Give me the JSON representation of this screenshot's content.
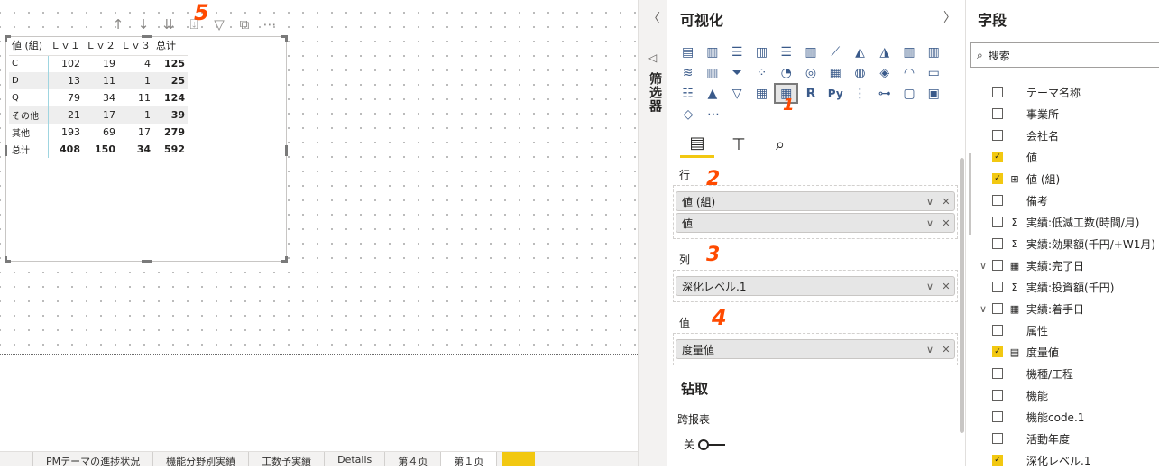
{
  "canvas": {
    "matrix": {
      "headers": [
        "値 (組)",
        "Ｌｖ１",
        "Ｌｖ２",
        "Ｌｖ３",
        "总计"
      ],
      "rows": [
        {
          "label": "C",
          "v1": "102",
          "v2": "19",
          "v3": "4",
          "total": "125"
        },
        {
          "label": "D",
          "v1": "13",
          "v2": "11",
          "v3": "1",
          "total": "25"
        },
        {
          "label": "Q",
          "v1": "79",
          "v2": "34",
          "v3": "11",
          "total": "124"
        },
        {
          "label": "その他",
          "v1": "21",
          "v2": "17",
          "v3": "1",
          "total": "39"
        },
        {
          "label": "其他",
          "v1": "193",
          "v2": "69",
          "v3": "17",
          "total": "279"
        }
      ],
      "grand_total": {
        "label": "总计",
        "v1": "408",
        "v2": "150",
        "v3": "34",
        "total": "592"
      }
    },
    "visual_header_icons": [
      "arrow-up-icon",
      "arrow-down-icon",
      "double-arrow-down-icon",
      "expand-hierarchy-icon",
      "filter-icon",
      "focus-mode-icon",
      "more-options-icon"
    ],
    "annotations": [
      "1",
      "2",
      "3",
      "4",
      "5"
    ]
  },
  "page_tabs": [
    "",
    "PMテーマの進捗状況",
    "機能分野別実績",
    "工数予実績",
    "Details",
    "第４页",
    "第１页"
  ],
  "filters_pane": {
    "label": "筛选器"
  },
  "visualizations": {
    "title": "可视化",
    "tabs": [
      "fields-tab",
      "format-tab",
      "analytics-tab"
    ],
    "wells": {
      "rows_title": "行",
      "rows_fields": [
        "値 (組)",
        "値"
      ],
      "columns_title": "列",
      "columns_fields": [
        "深化レベル.1"
      ],
      "values_title": "值",
      "values_fields": [
        "度量値"
      ]
    },
    "drill_title": "钻取",
    "cross_report_label": "跨报表",
    "toggle_label": "关"
  },
  "fields": {
    "title": "字段",
    "search_placeholder": "搜索",
    "items": [
      {
        "name": "テーマ名称",
        "checked": false,
        "icon": "",
        "expand": ""
      },
      {
        "name": "事業所",
        "checked": false,
        "icon": "",
        "expand": ""
      },
      {
        "name": "会社名",
        "checked": false,
        "icon": "",
        "expand": ""
      },
      {
        "name": "値",
        "checked": true,
        "icon": "",
        "expand": ""
      },
      {
        "name": "値 (組)",
        "checked": true,
        "icon": "⊞",
        "expand": ""
      },
      {
        "name": "備考",
        "checked": false,
        "icon": "",
        "expand": ""
      },
      {
        "name": "実績:低減工数(時間/月)",
        "checked": false,
        "icon": "Σ",
        "expand": ""
      },
      {
        "name": "実績:効果額(千円/+W1月)",
        "checked": false,
        "icon": "Σ",
        "expand": ""
      },
      {
        "name": "実績:完了日",
        "checked": false,
        "icon": "▦",
        "expand": "∨"
      },
      {
        "name": "実績:投資額(千円)",
        "checked": false,
        "icon": "Σ",
        "expand": ""
      },
      {
        "name": "実績:着手日",
        "checked": false,
        "icon": "▦",
        "expand": "∨"
      },
      {
        "name": "属性",
        "checked": false,
        "icon": "",
        "expand": ""
      },
      {
        "name": "度量値",
        "checked": true,
        "icon": "▤",
        "expand": ""
      },
      {
        "name": "機種/工程",
        "checked": false,
        "icon": "",
        "expand": ""
      },
      {
        "name": "機能",
        "checked": false,
        "icon": "",
        "expand": ""
      },
      {
        "name": "機能code.1",
        "checked": false,
        "icon": "",
        "expand": ""
      },
      {
        "name": "活動年度",
        "checked": false,
        "icon": "",
        "expand": ""
      },
      {
        "name": "深化レベル.1",
        "checked": true,
        "icon": "",
        "expand": ""
      }
    ]
  },
  "colors": {
    "accent": "#f2c811",
    "annotation": "#ff4a00",
    "row_stripe": "#eeeeee"
  }
}
